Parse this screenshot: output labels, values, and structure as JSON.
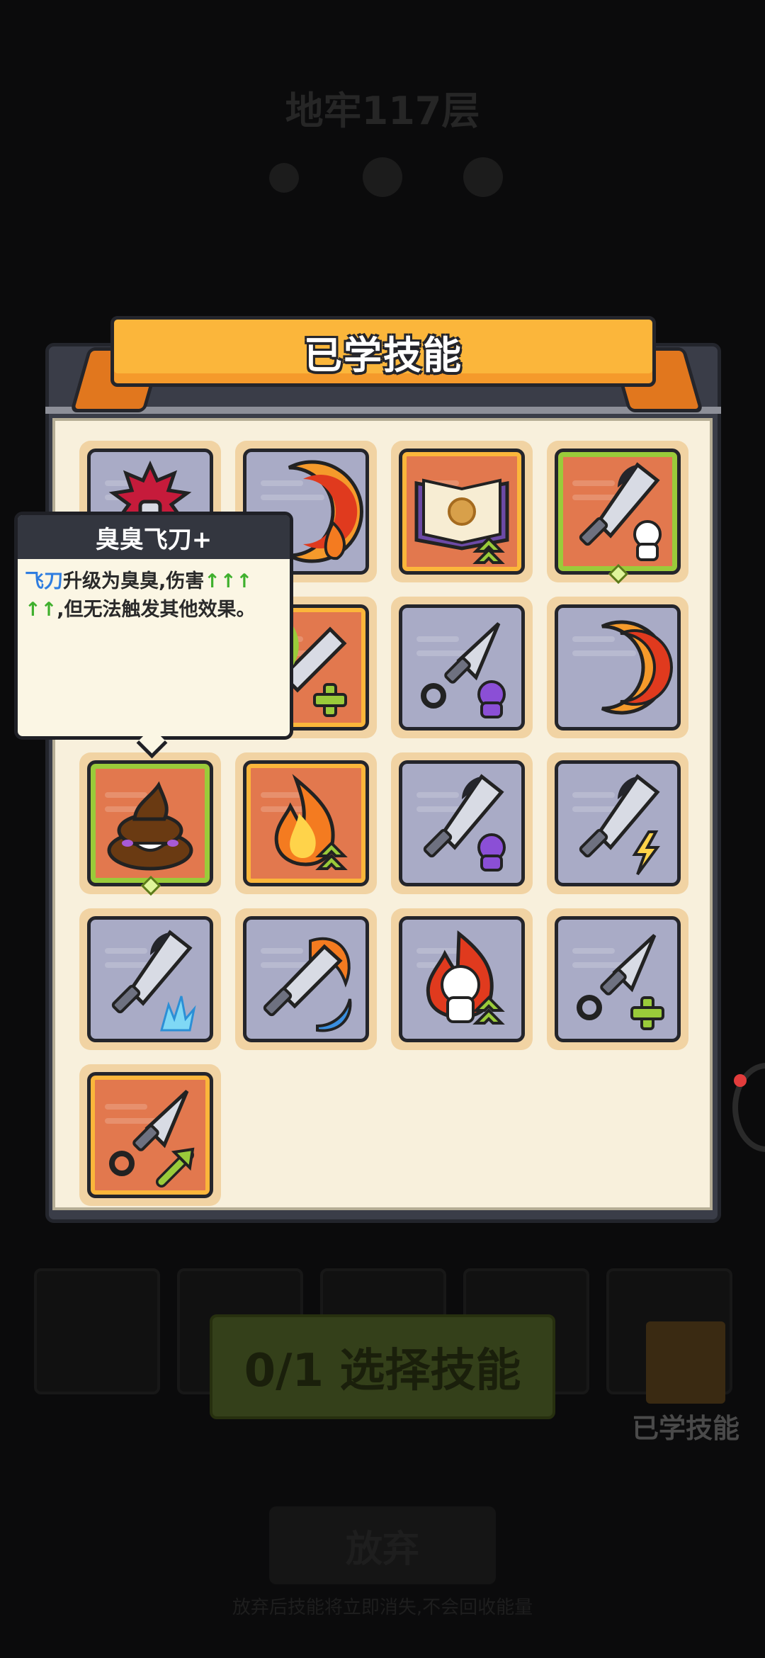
{
  "background": {
    "floor_title": "地牢117层",
    "select_button_label": "0/1 选择技能",
    "learned_skills_label": "已学技能",
    "abandon_label": "放弃",
    "footer_note": "放弃后技能将立即消失,不会回收能量"
  },
  "panel": {
    "title": "已学技能"
  },
  "tooltip": {
    "title": "臭臭飞刀+",
    "keyword": "飞刀",
    "text_upgrade": "升级为臭臭,伤害",
    "arrows_line1": "↑↑↑",
    "arrows_line2": "↑↑",
    "text_tail": ",但无法触发其他效果。"
  },
  "skills": [
    {
      "icon": "spiky-burst-sword-icon",
      "frame": "gray"
    },
    {
      "icon": "crescent-fire-icon",
      "frame": "gray"
    },
    {
      "icon": "sun-book-upgrade-icon",
      "frame": "orange-gold"
    },
    {
      "icon": "cleaver-skull-icon",
      "frame": "green"
    },
    {
      "icon": "feather-sword-plus-icon",
      "frame": "orange-gold"
    },
    {
      "icon": "dagger-purple-skull-icon",
      "frame": "gray"
    },
    {
      "icon": "double-crescent-icon",
      "frame": "gray"
    },
    {
      "icon": "poop-icon",
      "frame": "green"
    },
    {
      "icon": "fire-upgrade-icon",
      "frame": "orange-gold"
    },
    {
      "icon": "cleaver-purple-skull-icon",
      "frame": "gray"
    },
    {
      "icon": "cleaver-lightning-icon",
      "frame": "gray"
    },
    {
      "icon": "cleaver-ice-icon",
      "frame": "gray"
    },
    {
      "icon": "sword-fire-water-icon",
      "frame": "gray"
    },
    {
      "icon": "burning-skull-upgrade-icon",
      "frame": "gray"
    },
    {
      "icon": "dagger-plus-icon",
      "frame": "gray"
    },
    {
      "icon": "dagger-arrow-icon",
      "frame": "orange-gold"
    }
  ]
}
